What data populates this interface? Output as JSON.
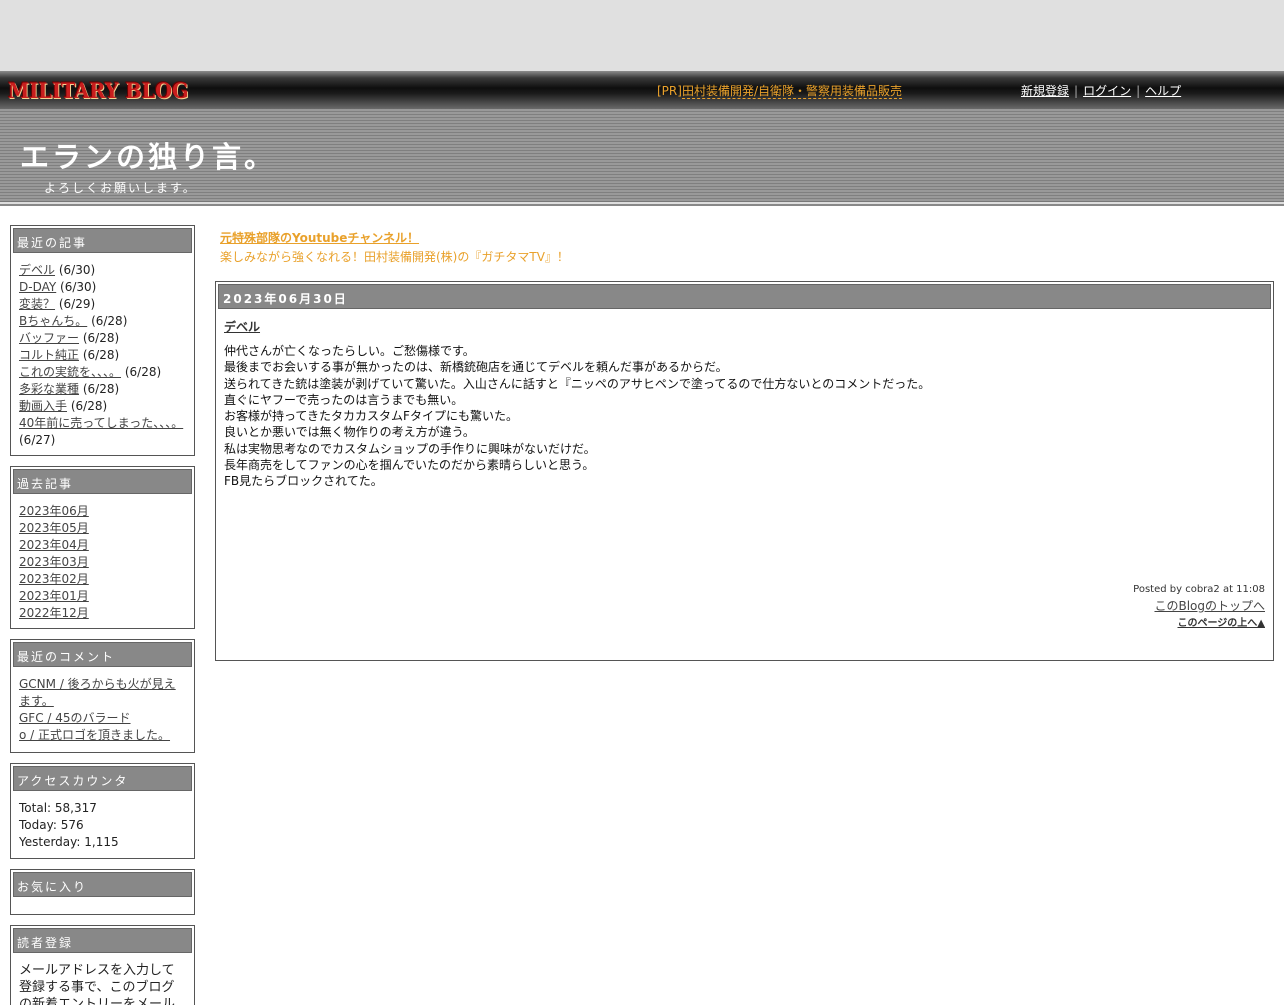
{
  "navbar": {
    "logo": "MILITARY BLOG",
    "pr_prefix": "[PR]",
    "pr_link": "田村装備開発/自衛隊・警察用装備品販売",
    "register": "新規登録",
    "login": "ログイン",
    "help": "ヘルプ",
    "separator": "|"
  },
  "header": {
    "title": "エランの独り言。",
    "description": "よろしくお願いします。"
  },
  "sidebar": {
    "recent_posts": {
      "title": "最近の記事",
      "items": [
        {
          "label": "デベル",
          "date": "(6/30)"
        },
        {
          "label": "D-DAY",
          "date": "(6/30)"
        },
        {
          "label": "変装？",
          "date": "(6/29)"
        },
        {
          "label": "Bちゃんち。",
          "date": "(6/28)"
        },
        {
          "label": "バッファー",
          "date": "(6/28)"
        },
        {
          "label": "コルト純正",
          "date": "(6/28)"
        },
        {
          "label": "これの実銃を、、、。",
          "date": "(6/28)"
        },
        {
          "label": "多彩な業種",
          "date": "(6/28)"
        },
        {
          "label": "動画入手",
          "date": "(6/28)"
        },
        {
          "label": "40年前に売ってしまった、、、。",
          "date": "(6/27)"
        }
      ]
    },
    "archives": {
      "title": "過去記事",
      "items": [
        "2023年06月",
        "2023年05月",
        "2023年04月",
        "2023年03月",
        "2023年02月",
        "2023年01月",
        "2022年12月"
      ]
    },
    "recent_comments": {
      "title": "最近のコメント",
      "items": [
        "GCNM / 後ろからも火が見えます。",
        "GFC / 45のバラード",
        "o / 正式ロゴを頂きました。"
      ]
    },
    "access_counter": {
      "title": "アクセスカウンタ",
      "total": "Total: 58,317",
      "today": "Today: 576",
      "yesterday": "Yesterday: 1,115"
    },
    "favorites": {
      "title": "お気に入り"
    },
    "reader_register": {
      "title": "読者登録",
      "text": "メールアドレスを入力して登録する事で、このブログの新着エントリーをメールでお届"
    }
  },
  "promo": {
    "link": "元特殊部隊のYoutubeチャンネル！",
    "text": "楽しみながら強くなれる！田村装備開発(株)の『ガチタマTV』！"
  },
  "entry": {
    "date": "2023年06月30日",
    "title": "デベル",
    "lines": [
      "仲代さんが亡くなったらしい。ご愁傷様です。",
      "最後までお会いする事が無かったのは、新橋銃砲店を通じてデベルを頼んだ事があるからだ。",
      "送られてきた銃は塗装が剥げていて驚いた。入山さんに話すと『ニッペのアサヒペンで塗ってるので仕方ないとのコメントだった。",
      "直ぐにヤフーで売ったのは言うまでも無い。",
      "お客様が持ってきたタカカスタムFタイプにも驚いた。",
      "良いとか悪いでは無く物作りの考え方が違う。",
      "私は実物思考なのでカスタムショップの手作りに興味がないだけだ。",
      "長年商売をしてファンの心を掴んでいたのだから素晴らしいと思う。",
      "FB見たらブロックされてた。"
    ],
    "posted_by": "Posted by cobra2 at 11:08",
    "blog_top": "このBlogのトップへ",
    "page_top": "このページの上へ▲"
  }
}
